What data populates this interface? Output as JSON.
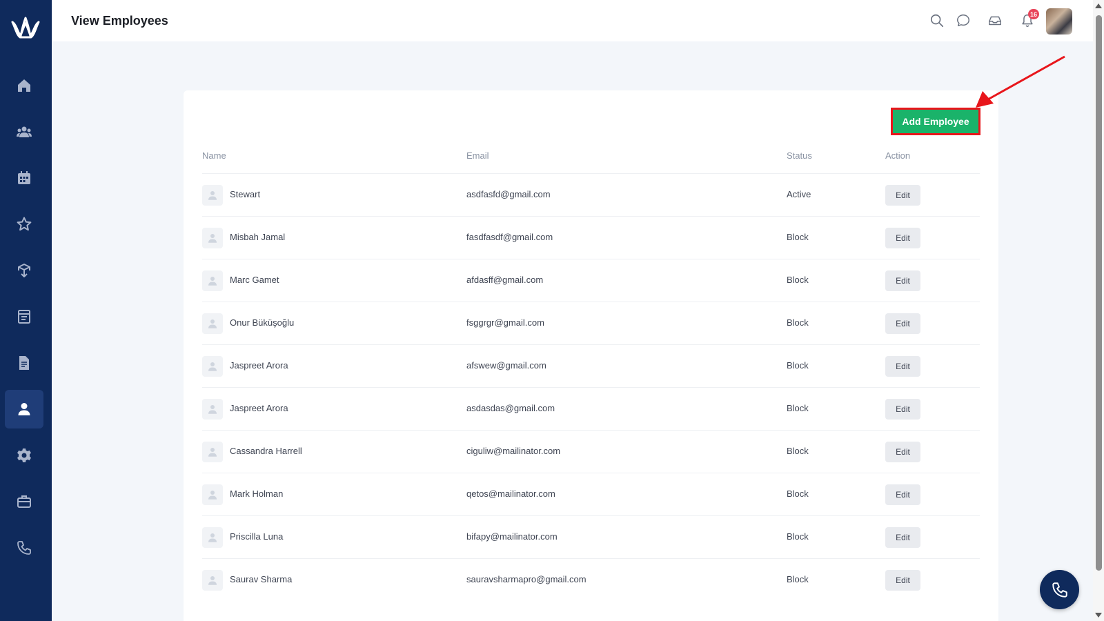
{
  "header": {
    "title": "View Employees",
    "notification_count": "16"
  },
  "sidebar": {
    "items": [
      {
        "icon": "home-icon"
      },
      {
        "icon": "users-icon"
      },
      {
        "icon": "calendar-icon"
      },
      {
        "icon": "star-icon"
      },
      {
        "icon": "box-icon"
      },
      {
        "icon": "schedule-icon"
      },
      {
        "icon": "document-icon"
      },
      {
        "icon": "user-icon",
        "active": true
      },
      {
        "icon": "gear-icon"
      },
      {
        "icon": "briefcase-icon"
      },
      {
        "icon": "phone-icon"
      }
    ]
  },
  "actions": {
    "add_employee_label": "Add Employee"
  },
  "table": {
    "columns": [
      "Name",
      "Email",
      "Status",
      "Action"
    ],
    "edit_label": "Edit",
    "rows": [
      {
        "name": "Stewart",
        "email": "asdfasfd@gmail.com",
        "status": "Active"
      },
      {
        "name": "Misbah Jamal",
        "email": "fasdfasdf@gmail.com",
        "status": "Block"
      },
      {
        "name": "Marc Gamet",
        "email": "afdasff@gmail.com",
        "status": "Block"
      },
      {
        "name": "Onur Büküşoğlu",
        "email": "fsggrgr@gmail.com",
        "status": "Block"
      },
      {
        "name": "Jaspreet Arora",
        "email": "afswew@gmail.com",
        "status": "Block"
      },
      {
        "name": "Jaspreet Arora",
        "email": "asdasdas@gmail.com",
        "status": "Block"
      },
      {
        "name": "Cassandra Harrell",
        "email": "ciguliw@mailinator.com",
        "status": "Block"
      },
      {
        "name": "Mark Holman",
        "email": "qetos@mailinator.com",
        "status": "Block"
      },
      {
        "name": "Priscilla Luna",
        "email": "bifapy@mailinator.com",
        "status": "Block"
      },
      {
        "name": "Saurav Sharma",
        "email": "sauravsharmapro@gmail.com",
        "status": "Block"
      }
    ]
  },
  "colors": {
    "sidebar": "#0f2a5c",
    "accent_green": "#1ab36a",
    "highlight_red": "#e8161b",
    "badge": "#e8455a"
  }
}
